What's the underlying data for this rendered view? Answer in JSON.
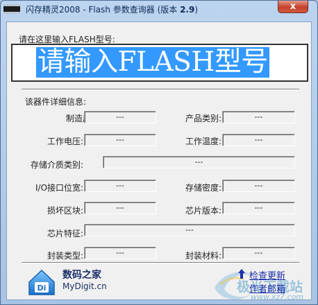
{
  "window": {
    "title_prefix": "闪存精灵2008 - Flash 参数查询器 (版本 ",
    "title_version": "2.9",
    "title_suffix": ")",
    "close_label": "x"
  },
  "input": {
    "label": "请在这里输入FLASH型号:",
    "value": "请输入FLASH型号"
  },
  "details": {
    "title": "该器件详细信息:",
    "fields": [
      {
        "label": "制造厂商:",
        "value": "---"
      },
      {
        "label": "产品类别:",
        "value": "---"
      },
      {
        "label": "工作电压:",
        "value": "---"
      },
      {
        "label": "工作温度:",
        "value": "---"
      },
      {
        "label": "存储介质类别:",
        "value": "---"
      },
      {
        "label": "I/O接口位宽:",
        "value": "---"
      },
      {
        "label": "存储密度:",
        "value": "---"
      },
      {
        "label": "损坏区块:",
        "value": "---"
      },
      {
        "label": "芯片版本:",
        "value": "---"
      },
      {
        "label": "芯片特征:",
        "value": "---"
      },
      {
        "label": "封装类型:",
        "value": "---"
      },
      {
        "label": "封装材料:",
        "value": "---"
      }
    ]
  },
  "footer": {
    "brand_cn": "数码之家",
    "brand_en": "MyDigit.cn",
    "check_update": "检查更新",
    "author_email": "作者邮箱",
    "watermark_text": "极光下载站",
    "watermark_url": "www.xz7.com"
  },
  "colors": {
    "selection": "#3399ff",
    "link": "#1b2ea8",
    "frame": "#aac4e2",
    "close": "#c4412b"
  }
}
